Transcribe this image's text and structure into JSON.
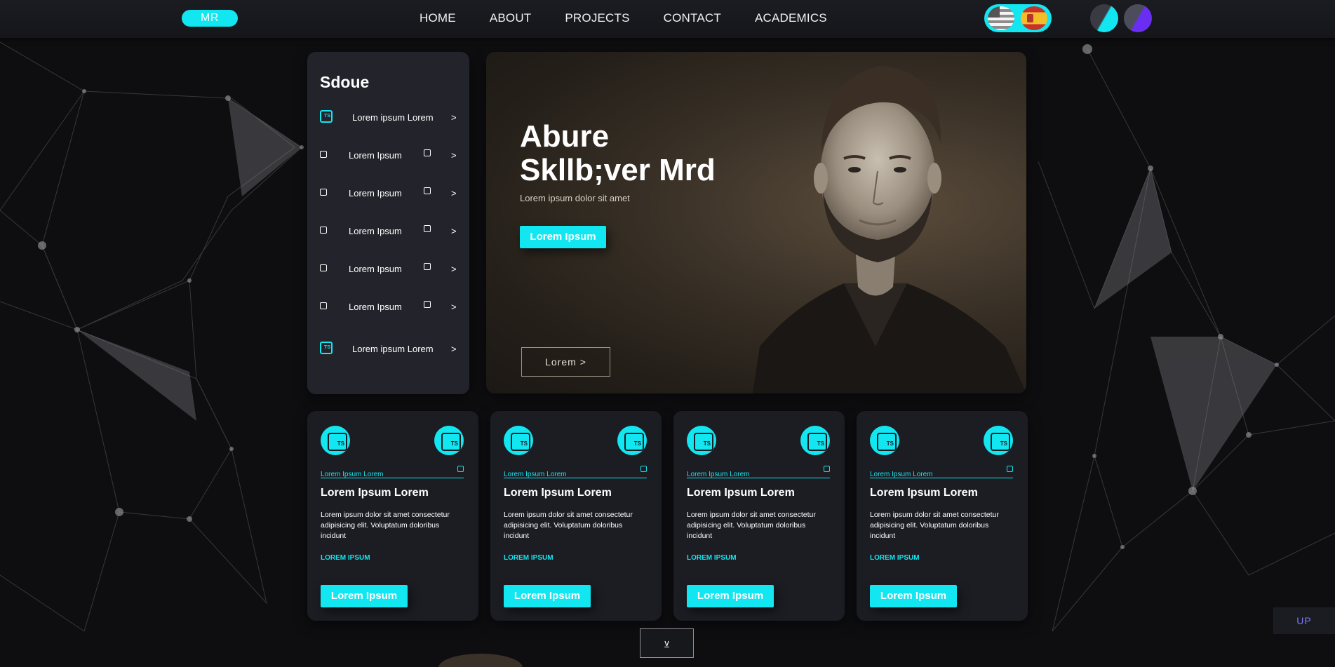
{
  "nav": {
    "logo": "MR",
    "links": [
      "HOME",
      "ABOUT",
      "PROJECTS",
      "CONTACT",
      "ACADEMICS"
    ],
    "lang_flags": [
      "us-flag-icon",
      "es-flag-icon"
    ],
    "theme_buttons": [
      "theme-cyan",
      "theme-purple"
    ]
  },
  "sidebar": {
    "title": "Sdoue",
    "items": [
      {
        "label": "Lorem ipsum Lorem",
        "chevron": ">"
      },
      {
        "label": "Lorem Ipsum",
        "chevron": ">"
      },
      {
        "label": "Lorem Ipsum",
        "chevron": ">"
      },
      {
        "label": "Lorem Ipsum",
        "chevron": ">"
      },
      {
        "label": "Lorem Ipsum",
        "chevron": ">"
      },
      {
        "label": "Lorem Ipsum",
        "chevron": ">"
      },
      {
        "label": "Lorem ipsum Lorem",
        "chevron": ">"
      }
    ]
  },
  "hero": {
    "title_line1": "Abure",
    "title_line2": "Skllb;ver Mrd",
    "subtitle": "Lorem ipsum dolor sit amet",
    "cta": "Lorem Ipsum",
    "outline_button": "Lorem >"
  },
  "cards": [
    {
      "meta": "Lorem Ipsum Lorem",
      "title": "Lorem Ipsum Lorem",
      "body": "Lorem ipsum dolor sit amet consectetur adipisicing elit. Voluptatum doloribus incidunt",
      "tag": "LOREM IPSUM",
      "button": "Lorem Ipsum"
    },
    {
      "meta": "Lorem Ipsum Lorem",
      "title": "Lorem Ipsum Lorem",
      "body": "Lorem ipsum dolor sit amet consectetur adipisicing elit. Voluptatum doloribus incidunt",
      "tag": "LOREM IPSUM",
      "button": "Lorem Ipsum"
    },
    {
      "meta": "Lorem Ipsum Lorem",
      "title": "Lorem Ipsum Lorem",
      "body": "Lorem ipsum dolor sit amet consectetur adipisicing elit. Voluptatum doloribus incidunt",
      "tag": "LOREM IPSUM",
      "button": "Lorem Ipsum"
    },
    {
      "meta": "Lorem Ipsum Lorem",
      "title": "Lorem Ipsum Lorem",
      "body": "Lorem ipsum dolor sit amet consectetur adipisicing elit. Voluptatum doloribus incidunt",
      "tag": "LOREM IPSUM",
      "button": "Lorem Ipsum"
    }
  ],
  "scroll_down": "v",
  "scroll_up": "UP",
  "colors": {
    "accent": "#12e6f0",
    "background": "#0e0e11",
    "panel": "#23242b",
    "card": "#1c1d23",
    "up_text": "#7c77ff"
  }
}
